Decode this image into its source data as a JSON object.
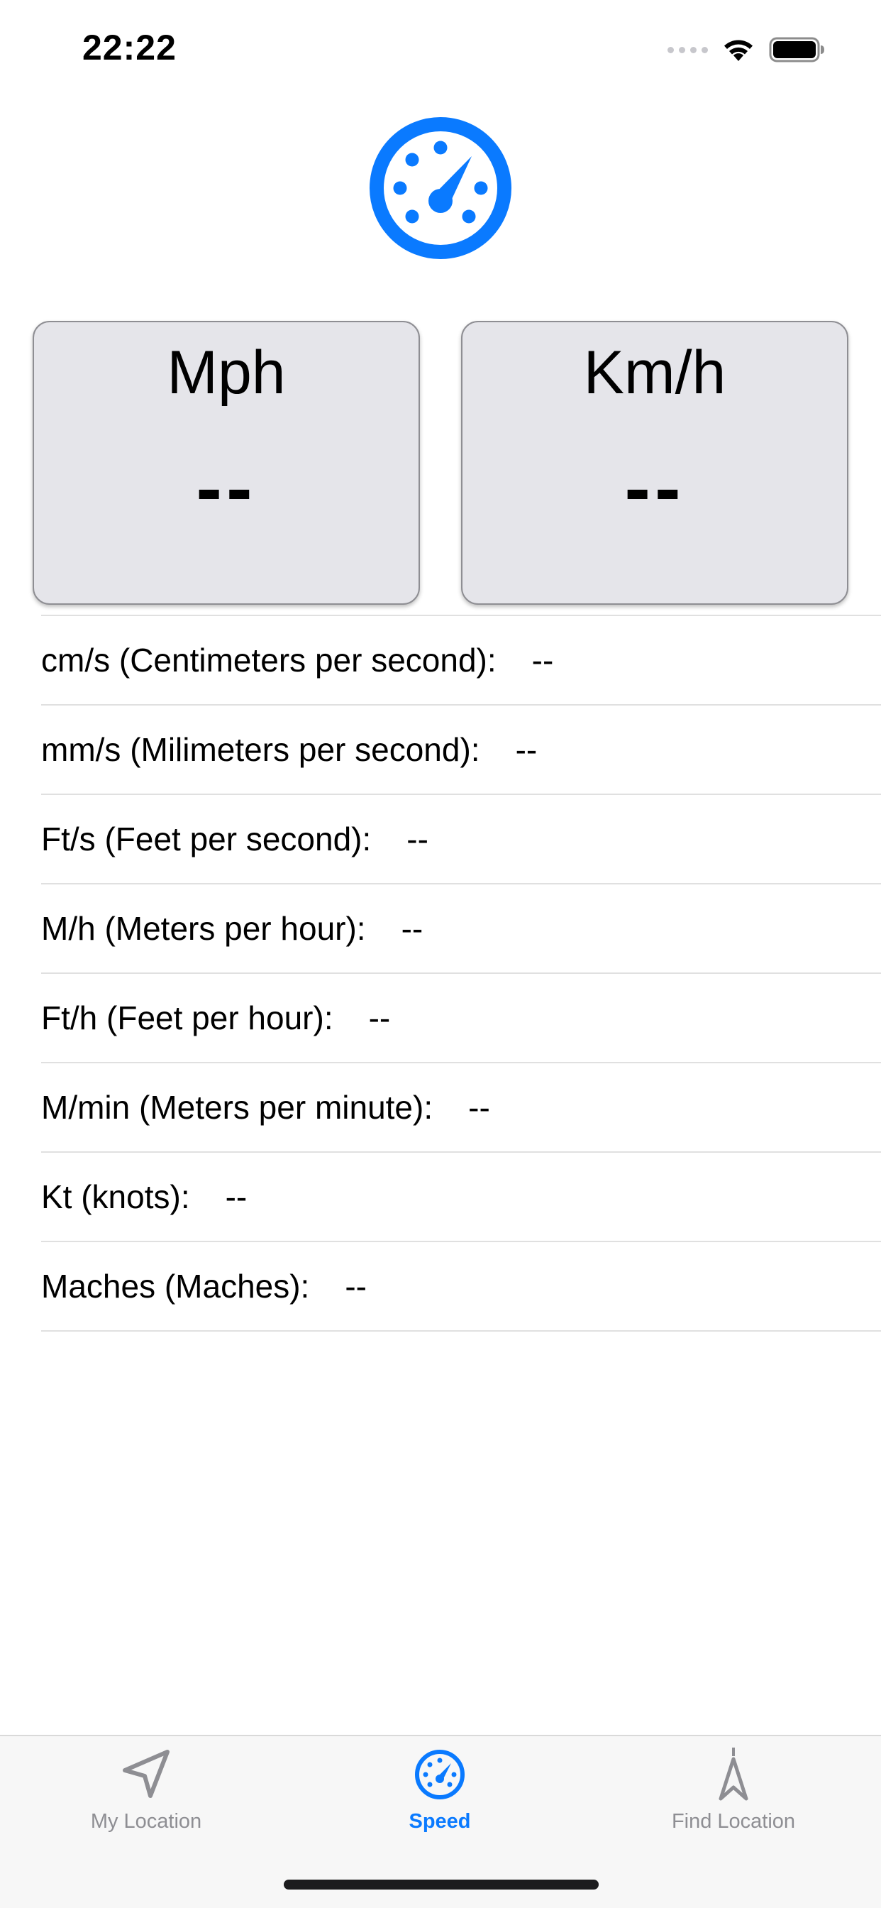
{
  "status_bar": {
    "time": "22:22",
    "icons": [
      "signal-dots-icon",
      "wifi-icon",
      "battery-icon"
    ]
  },
  "header": {
    "icon": "speedometer-icon",
    "accent_color": "#0a7aff"
  },
  "cards": [
    {
      "title": "Mph",
      "value": "--"
    },
    {
      "title": "Km/h",
      "value": "--"
    }
  ],
  "units": [
    {
      "label": "cm/s (Centimeters per second):",
      "value": "--"
    },
    {
      "label": "mm/s (Milimeters per second):",
      "value": "--"
    },
    {
      "label": "Ft/s (Feet per second):",
      "value": "--"
    },
    {
      "label": "M/h (Meters per hour):",
      "value": "--"
    },
    {
      "label": "Ft/h (Feet per hour):",
      "value": "--"
    },
    {
      "label": "M/min (Meters per minute):",
      "value": "--"
    },
    {
      "label": "Kt (knots):",
      "value": "--"
    },
    {
      "label": "Maches (Maches):",
      "value": "--"
    }
  ],
  "tab_bar": {
    "tabs": [
      {
        "label": "My Location",
        "icon": "location-arrow-icon",
        "active": false
      },
      {
        "label": "Speed",
        "icon": "speedometer-icon",
        "active": true
      },
      {
        "label": "Find Location",
        "icon": "navigation-arrow-icon",
        "active": false
      }
    ],
    "active_color": "#0a7aff",
    "inactive_color": "#8e8e93"
  }
}
